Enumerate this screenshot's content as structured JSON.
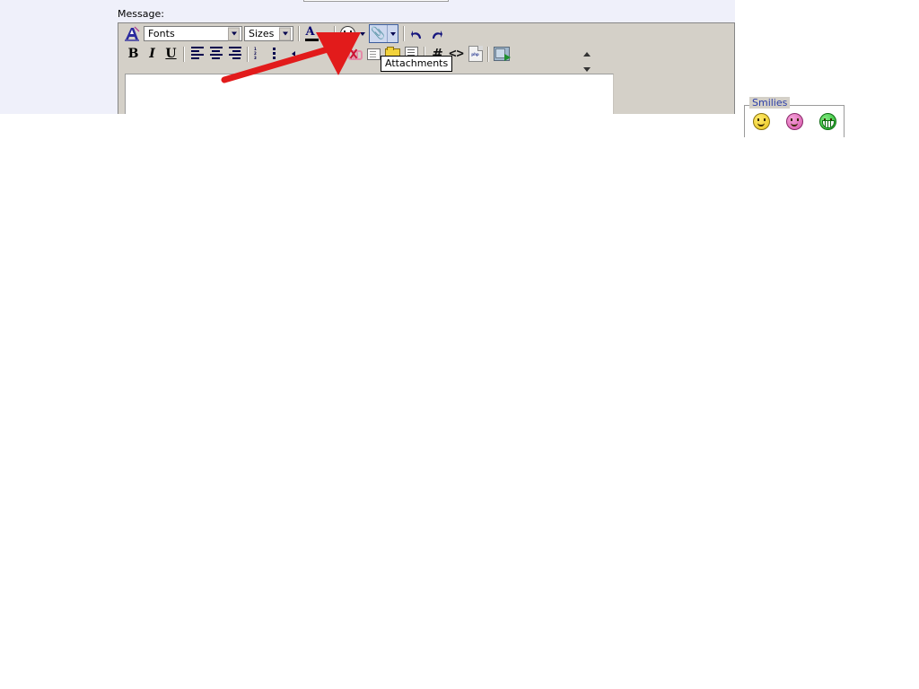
{
  "page": {
    "background_color": "#eff0fa",
    "panel_color": "#d4d0c8",
    "accent_blue": "#2c3ea8",
    "annotation_color": "#e21b1b",
    "highlight_fill": "#cdd8ef",
    "highlight_border": "#3b5c9c"
  },
  "form": {
    "message_label": "Message:",
    "top_field_value": ""
  },
  "editor": {
    "body_text": "",
    "toolbar": {
      "row1": {
        "logo_title": "editor-logo",
        "font_select": {
          "value": "Fonts",
          "options": [
            "Fonts"
          ]
        },
        "size_select": {
          "value": "Sizes",
          "options": [
            "Sizes"
          ]
        },
        "font_color_label": "A",
        "font_color_value": "#000000",
        "emoticon_label": "smiley",
        "attachments_label": "Attachments",
        "undo_label": "Undo",
        "redo_label": "Redo",
        "resize_label": "Resize"
      },
      "row2": {
        "bold_label": "B",
        "italic_label": "I",
        "underline_label": "U",
        "align_left_label": "Align Left",
        "align_center_label": "Align Center",
        "align_right_label": "Align Right",
        "ordered_list_label": "Ordered List",
        "unordered_list_label": "Unordered List",
        "outdent_label": "Outdent",
        "indent_label": "Indent",
        "link_label": "Insert Link",
        "unlink_label": "Remove Link",
        "page_label": "Insert Page",
        "folder_label": "Browse",
        "note_label": "Quote",
        "hash_label": "#",
        "code_label": "<>",
        "php_label": "php",
        "image_label": "Insert Image"
      }
    }
  },
  "tooltip": {
    "text": "Attachments",
    "target": "attachments-button"
  },
  "smilies": {
    "legend": "Smilies",
    "items": [
      {
        "name": "smiley-happy",
        "color": "#e8c520"
      },
      {
        "name": "smiley-blush",
        "color": "#d558aa"
      },
      {
        "name": "smiley-grin",
        "color": "#22b52a"
      }
    ]
  },
  "annotation": {
    "type": "arrow",
    "color": "#e21b1b",
    "from": [
      250,
      89
    ],
    "to": [
      388,
      42
    ],
    "points_at": "attachments-button"
  }
}
